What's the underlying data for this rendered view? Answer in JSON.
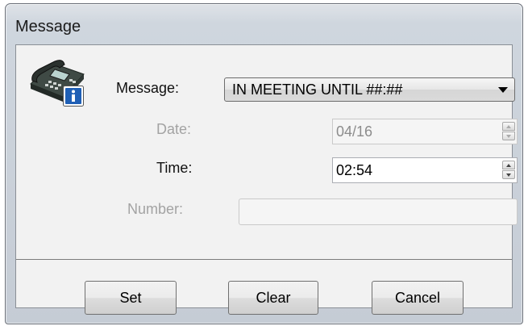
{
  "window": {
    "title": "Message"
  },
  "icons": {
    "phone": "desk-phone-icon",
    "info": "info-icon"
  },
  "form": {
    "message_label": "Message:",
    "message_value": "IN MEETING UNTIL ##:##",
    "date_label": "Date:",
    "date_value": "04/16",
    "time_label": "Time:",
    "time_value": "02:54",
    "number_label": "Number:",
    "number_value": ""
  },
  "buttons": {
    "set": "Set",
    "clear": "Clear",
    "cancel": "Cancel"
  },
  "colors": {
    "window_frame": "#c5ccd5",
    "client_bg": "#f2f2f2",
    "disabled_text": "#a3a3a3",
    "info_badge": "#1f5fb5"
  }
}
